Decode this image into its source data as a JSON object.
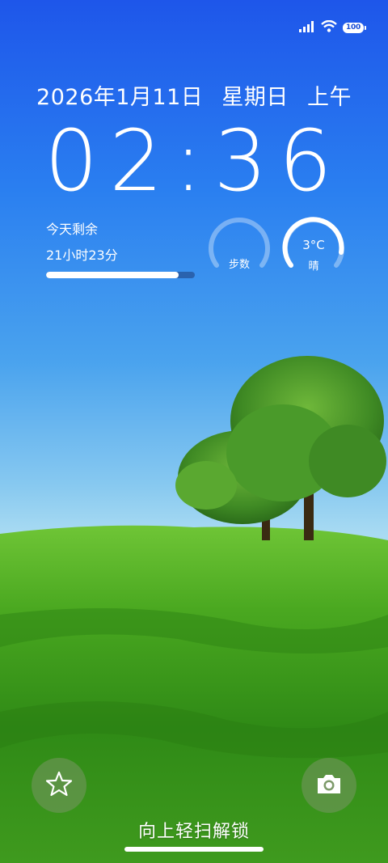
{
  "status": {
    "battery_level": "100",
    "icons": [
      "cellular-signal-icon",
      "wifi-icon",
      "battery-icon"
    ]
  },
  "lockscreen": {
    "date": "2026年1月11日",
    "weekday": "星期日",
    "period": "上午",
    "time": "02:36"
  },
  "remaining": {
    "label": "今天剩余",
    "value": "21小时23分",
    "progress_fraction": 0.89
  },
  "steps_widget": {
    "label": "步数",
    "progress_fraction": 0.0
  },
  "weather_widget": {
    "temperature": "3°C",
    "condition": "晴"
  },
  "bottom": {
    "unlock_hint": "向上轻扫解锁",
    "left_shortcut_icon": "star-icon",
    "right_shortcut_icon": "camera-icon"
  },
  "colors": {
    "sky_top": "#1e56ea",
    "sky_bottom": "#a9dbf2",
    "grass": "#3f9a1e",
    "widget_ring": "#ffffff"
  }
}
